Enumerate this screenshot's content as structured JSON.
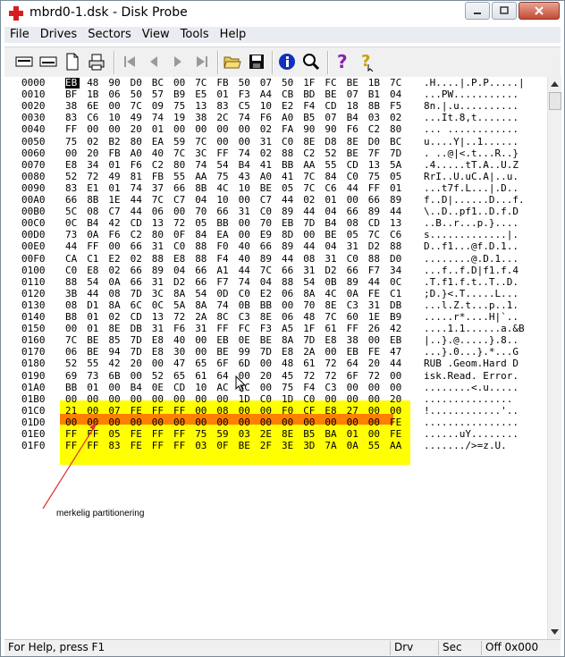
{
  "window": {
    "title": "mbrd0-1.dsk - Disk Probe"
  },
  "menu": [
    "File",
    "Drives",
    "Sectors",
    "View",
    "Tools",
    "Help"
  ],
  "toolbar": {
    "buttons": [
      "read-icon",
      "write-icon",
      "new-icon",
      "print-icon",
      "first-icon",
      "prev-icon",
      "next-icon",
      "last-icon",
      "open-icon",
      "save-icon",
      "info-icon",
      "find-icon",
      "help-icon",
      "context-help-icon"
    ]
  },
  "hex_rows": [
    {
      "offset": "0000",
      "bytes": [
        "EB",
        "48",
        "90",
        "D0",
        "BC",
        "00",
        "7C",
        "FB",
        "50",
        "07",
        "50",
        "1F",
        "FC",
        "BE",
        "1B",
        "7C"
      ],
      "ascii": ".H....|.P.P.....|"
    },
    {
      "offset": "0010",
      "bytes": [
        "BF",
        "1B",
        "06",
        "50",
        "57",
        "B9",
        "E5",
        "01",
        "F3",
        "A4",
        "CB",
        "BD",
        "BE",
        "07",
        "B1",
        "04"
      ],
      "ascii": "...PW..........."
    },
    {
      "offset": "0020",
      "bytes": [
        "38",
        "6E",
        "00",
        "7C",
        "09",
        "75",
        "13",
        "83",
        "C5",
        "10",
        "E2",
        "F4",
        "CD",
        "18",
        "8B",
        "F5"
      ],
      "ascii": "8n.|.u.........."
    },
    {
      "offset": "0030",
      "bytes": [
        "83",
        "C6",
        "10",
        "49",
        "74",
        "19",
        "38",
        "2C",
        "74",
        "F6",
        "A0",
        "B5",
        "07",
        "B4",
        "03",
        "02"
      ],
      "ascii": "...It.8,t......."
    },
    {
      "offset": "0040",
      "bytes": [
        "FF",
        "00",
        "00",
        "20",
        "01",
        "00",
        "00",
        "00",
        "00",
        "02",
        "FA",
        "90",
        "90",
        "F6",
        "C2",
        "80"
      ],
      "ascii": "... ............"
    },
    {
      "offset": "0050",
      "bytes": [
        "75",
        "02",
        "B2",
        "80",
        "EA",
        "59",
        "7C",
        "00",
        "00",
        "31",
        "C0",
        "8E",
        "D8",
        "8E",
        "D0",
        "BC"
      ],
      "ascii": "u....Y|..1......"
    },
    {
      "offset": "0060",
      "bytes": [
        "00",
        "20",
        "FB",
        "A0",
        "40",
        "7C",
        "3C",
        "FF",
        "74",
        "02",
        "88",
        "C2",
        "52",
        "BE",
        "7F",
        "7D"
      ],
      "ascii": ". ..@|<.t...R..}"
    },
    {
      "offset": "0070",
      "bytes": [
        "E8",
        "34",
        "01",
        "F6",
        "C2",
        "80",
        "74",
        "54",
        "B4",
        "41",
        "BB",
        "AA",
        "55",
        "CD",
        "13",
        "5A"
      ],
      "ascii": ".4.....tT.A..U.Z"
    },
    {
      "offset": "0080",
      "bytes": [
        "52",
        "72",
        "49",
        "81",
        "FB",
        "55",
        "AA",
        "75",
        "43",
        "A0",
        "41",
        "7C",
        "84",
        "C0",
        "75",
        "05"
      ],
      "ascii": "RrI..U.uC.A|..u."
    },
    {
      "offset": "0090",
      "bytes": [
        "83",
        "E1",
        "01",
        "74",
        "37",
        "66",
        "8B",
        "4C",
        "10",
        "BE",
        "05",
        "7C",
        "C6",
        "44",
        "FF",
        "01"
      ],
      "ascii": "...t7f.L...|.D.."
    },
    {
      "offset": "00A0",
      "bytes": [
        "66",
        "8B",
        "1E",
        "44",
        "7C",
        "C7",
        "04",
        "10",
        "00",
        "C7",
        "44",
        "02",
        "01",
        "00",
        "66",
        "89"
      ],
      "ascii": "f..D|......D...f."
    },
    {
      "offset": "00B0",
      "bytes": [
        "5C",
        "08",
        "C7",
        "44",
        "06",
        "00",
        "70",
        "66",
        "31",
        "C0",
        "89",
        "44",
        "04",
        "66",
        "89",
        "44"
      ],
      "ascii": "\\..D..pf1..D.f.D"
    },
    {
      "offset": "00C0",
      "bytes": [
        "0C",
        "B4",
        "42",
        "CD",
        "13",
        "72",
        "05",
        "BB",
        "00",
        "70",
        "EB",
        "7D",
        "B4",
        "08",
        "CD",
        "13"
      ],
      "ascii": "..B..r...p.}...."
    },
    {
      "offset": "00D0",
      "bytes": [
        "73",
        "0A",
        "F6",
        "C2",
        "80",
        "0F",
        "84",
        "EA",
        "00",
        "E9",
        "8D",
        "00",
        "BE",
        "05",
        "7C",
        "C6"
      ],
      "ascii": "s.............|."
    },
    {
      "offset": "00E0",
      "bytes": [
        "44",
        "FF",
        "00",
        "66",
        "31",
        "C0",
        "88",
        "F0",
        "40",
        "66",
        "89",
        "44",
        "04",
        "31",
        "D2",
        "88"
      ],
      "ascii": "D..f1...@f.D.1.."
    },
    {
      "offset": "00F0",
      "bytes": [
        "CA",
        "C1",
        "E2",
        "02",
        "88",
        "E8",
        "88",
        "F4",
        "40",
        "89",
        "44",
        "08",
        "31",
        "C0",
        "88",
        "D0"
      ],
      "ascii": "........@.D.1..."
    },
    {
      "offset": "0100",
      "bytes": [
        "C0",
        "E8",
        "02",
        "66",
        "89",
        "04",
        "66",
        "A1",
        "44",
        "7C",
        "66",
        "31",
        "D2",
        "66",
        "F7",
        "34"
      ],
      "ascii": "...f..f.D|f1.f.4"
    },
    {
      "offset": "0110",
      "bytes": [
        "88",
        "54",
        "0A",
        "66",
        "31",
        "D2",
        "66",
        "F7",
        "74",
        "04",
        "88",
        "54",
        "0B",
        "89",
        "44",
        "0C"
      ],
      "ascii": ".T.f1.f.t..T..D."
    },
    {
      "offset": "0120",
      "bytes": [
        "3B",
        "44",
        "08",
        "7D",
        "3C",
        "8A",
        "54",
        "0D",
        "C0",
        "E2",
        "06",
        "8A",
        "4C",
        "0A",
        "FE",
        "C1"
      ],
      "ascii": ";D.}<.T.....L..."
    },
    {
      "offset": "0130",
      "bytes": [
        "08",
        "D1",
        "8A",
        "6C",
        "0C",
        "5A",
        "8A",
        "74",
        "0B",
        "BB",
        "00",
        "70",
        "8E",
        "C3",
        "31",
        "DB"
      ],
      "ascii": "...l.Z.t...p..1."
    },
    {
      "offset": "0140",
      "bytes": [
        "B8",
        "01",
        "02",
        "CD",
        "13",
        "72",
        "2A",
        "8C",
        "C3",
        "8E",
        "06",
        "48",
        "7C",
        "60",
        "1E",
        "B9"
      ],
      "ascii": ".....r*....H|`.."
    },
    {
      "offset": "0150",
      "bytes": [
        "00",
        "01",
        "8E",
        "DB",
        "31",
        "F6",
        "31",
        "FF",
        "FC",
        "F3",
        "A5",
        "1F",
        "61",
        "FF",
        "26",
        "42"
      ],
      "ascii": "....1.1......a.&B"
    },
    {
      "offset": "0160",
      "bytes": [
        "7C",
        "BE",
        "85",
        "7D",
        "E8",
        "40",
        "00",
        "EB",
        "0E",
        "BE",
        "8A",
        "7D",
        "E8",
        "38",
        "00",
        "EB"
      ],
      "ascii": "|..}.@.....}.8.."
    },
    {
      "offset": "0170",
      "bytes": [
        "06",
        "BE",
        "94",
        "7D",
        "E8",
        "30",
        "00",
        "BE",
        "99",
        "7D",
        "E8",
        "2A",
        "00",
        "EB",
        "FE",
        "47"
      ],
      "ascii": "...}.0...}.*...G"
    },
    {
      "offset": "0180",
      "bytes": [
        "52",
        "55",
        "42",
        "20",
        "00",
        "47",
        "65",
        "6F",
        "6D",
        "00",
        "48",
        "61",
        "72",
        "64",
        "20",
        "44"
      ],
      "ascii": "RUB .Geom.Hard D"
    },
    {
      "offset": "0190",
      "bytes": [
        "69",
        "73",
        "6B",
        "00",
        "52",
        "65",
        "61",
        "64",
        "00",
        "20",
        "45",
        "72",
        "72",
        "6F",
        "72",
        "00"
      ],
      "ascii": "isk.Read. Error."
    },
    {
      "offset": "01A0",
      "bytes": [
        "BB",
        "01",
        "00",
        "B4",
        "0E",
        "CD",
        "10",
        "AC",
        "3C",
        "00",
        "75",
        "F4",
        "C3",
        "00",
        "00",
        "00"
      ],
      "ascii": "........<.u....."
    },
    {
      "offset": "01B0",
      "bytes": [
        "00",
        "00",
        "00",
        "00",
        "00",
        "00",
        "00",
        "00",
        "1D",
        "C0",
        "1D",
        "C0",
        "00",
        "00",
        "00",
        "20"
      ],
      "ascii": "............... "
    },
    {
      "offset": "01C0",
      "bytes": [
        "21",
        "00",
        "07",
        "FE",
        "FF",
        "FF",
        "00",
        "08",
        "00",
        "00",
        "F0",
        "CF",
        "E8",
        "27",
        "00",
        "00"
      ],
      "ascii": "!............'.."
    },
    {
      "offset": "01D0",
      "bytes": [
        "00",
        "00",
        "00",
        "00",
        "00",
        "00",
        "00",
        "00",
        "00",
        "00",
        "00",
        "00",
        "00",
        "00",
        "00",
        "FE"
      ],
      "ascii": "................"
    },
    {
      "offset": "01E0",
      "bytes": [
        "FF",
        "FF",
        "05",
        "FE",
        "FF",
        "FF",
        "75",
        "59",
        "03",
        "2E",
        "8E",
        "B5",
        "BA",
        "01",
        "00",
        "FE"
      ],
      "ascii": "......uY........"
    },
    {
      "offset": "01F0",
      "bytes": [
        "FF",
        "FF",
        "83",
        "FE",
        "FF",
        "FF",
        "03",
        "0F",
        "BE",
        "2F",
        "3E",
        "3D",
        "7A",
        "0A",
        "55",
        "AA"
      ],
      "ascii": "......./>=z.U."
    }
  ],
  "annotation": {
    "text": "merkelig partitionering"
  },
  "status": {
    "help": "For Help, press F1",
    "drv": "Drv",
    "sec": "Sec",
    "off": "Off 0x000"
  },
  "colors": {
    "highlight_yellow": "#ffff00",
    "highlight_orange": "#ff7f00",
    "arrow_red": "#e03030"
  }
}
